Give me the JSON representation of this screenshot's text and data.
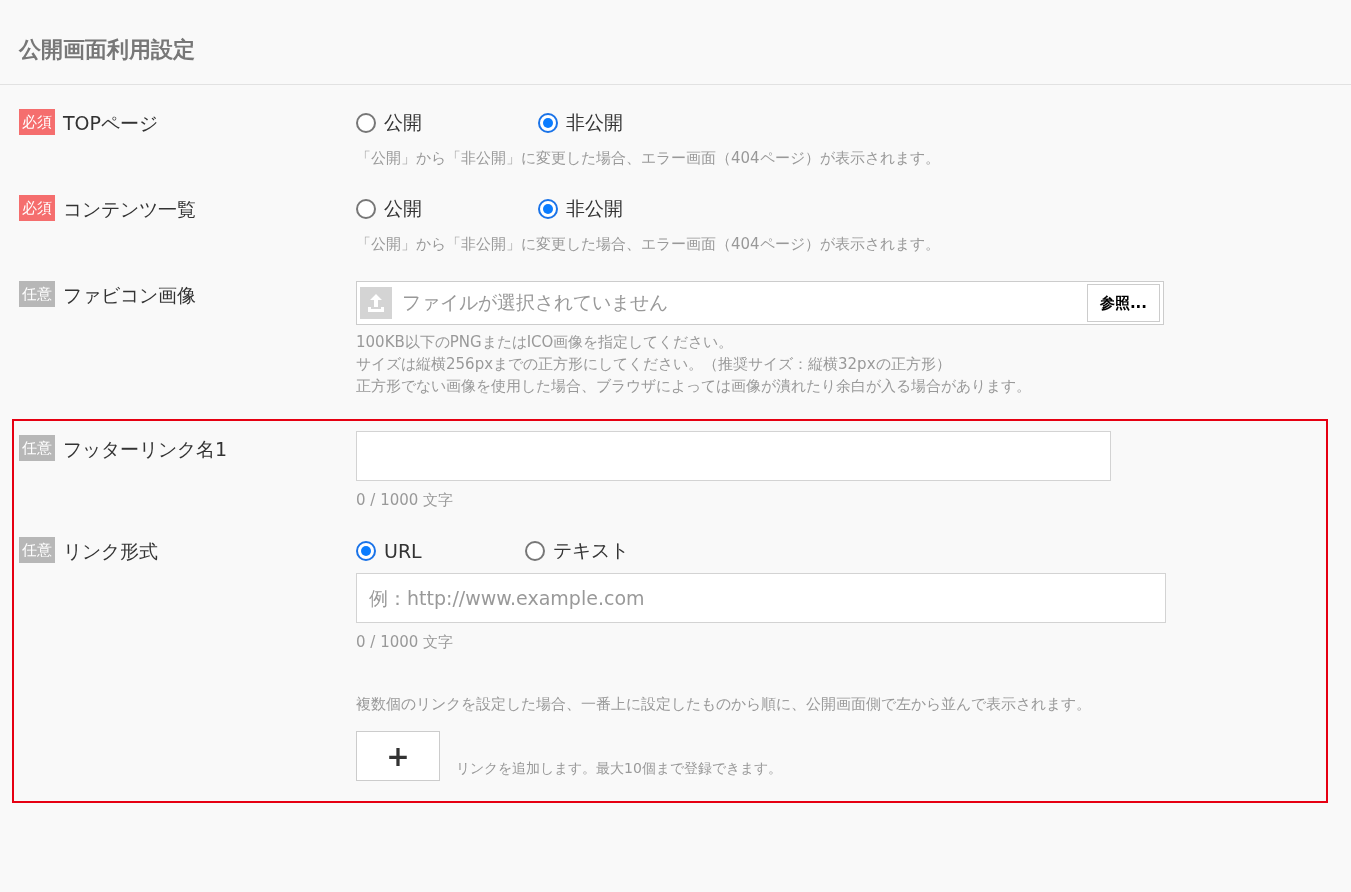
{
  "title": "公開画面利用設定",
  "fields": [
    {
      "kind": "radio",
      "badge": "必須",
      "required": true,
      "label": "TOPページ",
      "options": [
        {
          "label": "公開",
          "selected": false
        },
        {
          "label": "非公開",
          "selected": true
        }
      ],
      "notes": [
        "「公開」から「非公開」に変更した場合、エラー画面（404ページ）が表示されます。"
      ]
    },
    {
      "kind": "radio",
      "badge": "必須",
      "required": true,
      "label": "コンテンツ一覧",
      "options": [
        {
          "label": "公開",
          "selected": false
        },
        {
          "label": "非公開",
          "selected": true
        }
      ],
      "notes": [
        "「公開」から「非公開」に変更した場合、エラー画面（404ページ）が表示されます。"
      ]
    },
    {
      "kind": "file",
      "badge": "任意",
      "required": false,
      "label": "ファビコン画像",
      "placeholder": "ファイルが選択されていません",
      "button": "参照...",
      "notes": [
        "100KB以下のPNGまたはICO画像を指定してください。",
        "サイズは縦横256pxまでの正方形にしてください。（推奨サイズ：縦横32pxの正方形）",
        "正方形でない画像を使用した場合、ブラウザによっては画像が潰れたり余白が入る場合があります。"
      ]
    }
  ],
  "highlighted_fields": [
    {
      "kind": "text",
      "badge": "任意",
      "required": false,
      "label": "フッターリンク名1",
      "counter": "0 / 1000 文字"
    },
    {
      "kind": "link",
      "badge": "任意",
      "required": false,
      "label": "リンク形式",
      "options": [
        {
          "label": "URL",
          "selected": true
        },
        {
          "label": "テキスト",
          "selected": false
        }
      ],
      "placeholder": "例：http://www.example.com",
      "counter": "0 / 1000 文字",
      "note": "複数個のリンクを設定した場合、一番上に設定したものから順に、公開画面側で左から並んで表示されます。",
      "add_button": "+",
      "add_note": "リンクを追加します。最大10個まで登録できます。"
    }
  ]
}
